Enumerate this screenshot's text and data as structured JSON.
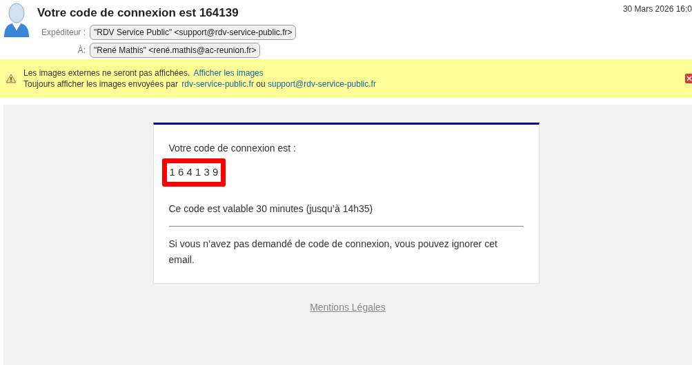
{
  "header": {
    "subject": "Votre code de connexion est 164139",
    "date": "30 Mars 2026 16:0",
    "fields": [
      {
        "label": "Expéditeur :",
        "value": "\"RDV Service Public\" <support@rdv-service-public.fr>"
      },
      {
        "label": "À:",
        "value": "\"René Mathis\" <rené.mathis@ac-reunion.fr>"
      }
    ]
  },
  "banner": {
    "line1": "Les images externes ne seront pas affichées.",
    "show_link": "Afficher les images",
    "line2": "Toujours afficher les images envoyées par",
    "domain_link": "rdv-service-public.fr",
    "or": "ou",
    "sender_link": "support@rdv-service-public.fr"
  },
  "email": {
    "intro": "Votre code de connexion est :",
    "code": "1 6 4 1 3 9",
    "highlighted": true,
    "validity": "Ce code est valable 30 minutes (jusqu’à 14h35)",
    "ignore": "Si vous n’avez pas demandé de code de connexion, vous pouvez ignorer cet email.",
    "footer_link": "Mentions Légales"
  }
}
